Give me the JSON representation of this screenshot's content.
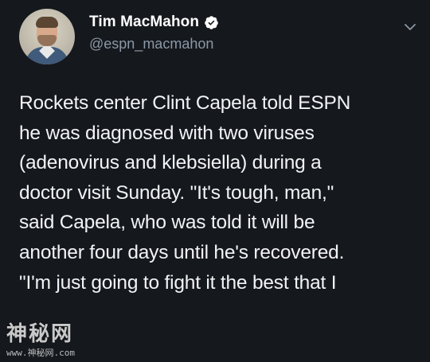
{
  "tweet": {
    "author": {
      "display_name": "Tim MacMahon",
      "handle": "@espn_macmahon",
      "verified": true,
      "avatar_icon": "profile-photo"
    },
    "menu_icon": "chevron-down-icon",
    "text_lines": [
      "Rockets center Clint Capela told ESPN",
      "he was diagnosed with two viruses",
      "(adenovirus and klebsiella) during a",
      "doctor visit Sunday. \"It's tough, man,\"",
      "said Capela, who was told it will be",
      "another four days until he's recovered.",
      "\"I'm just going to fight it the best that I"
    ]
  },
  "watermark": {
    "title": "神秘网",
    "url": "www.神秘网.com"
  },
  "colors": {
    "background": "#15181d",
    "text": "#f2f3f5",
    "secondary": "#8b98a5",
    "verified": "#ffffff"
  }
}
